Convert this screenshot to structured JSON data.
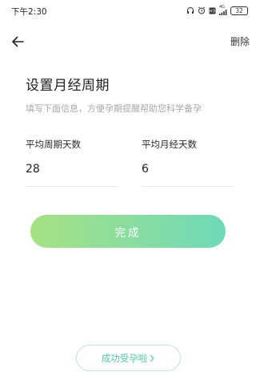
{
  "status_bar": {
    "time": "下午2:30",
    "network_label": "4G",
    "battery": "32",
    "icons": [
      "headphones-icon",
      "alarm-icon",
      "hd-icon",
      "signal-icon",
      "battery-icon"
    ]
  },
  "nav": {
    "back_icon": "arrow-left-icon",
    "delete_label": "删除"
  },
  "page": {
    "title": "设置月经周期",
    "subtitle": "填写下面信息，方便孕期提醒帮助您科学备孕"
  },
  "fields": {
    "cycle_days": {
      "label": "平均周期天数",
      "value": "28"
    },
    "period_days": {
      "label": "平均月经天数",
      "value": "6"
    }
  },
  "done_button": {
    "label": "完成",
    "gradient_start": "#a6e184",
    "gradient_end": "#6ed9b8"
  },
  "success_button": {
    "label": "成功受孕啦",
    "icon": "chevron-right-icon",
    "color": "#57c4a6"
  }
}
